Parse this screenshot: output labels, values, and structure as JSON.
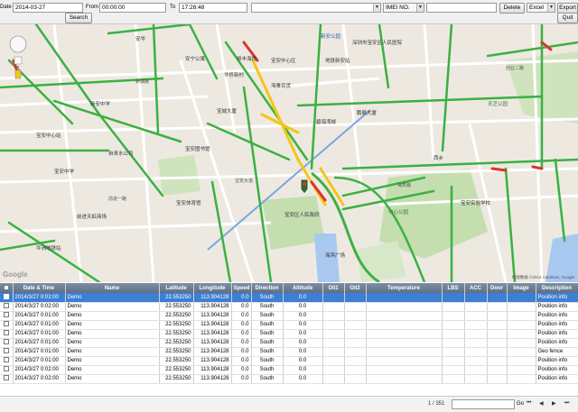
{
  "toolbar": {
    "date_label": "Date",
    "date_value": "2014-03-27",
    "from_label": "From",
    "from_value": "00:00:00",
    "to_label": "To",
    "to_value": "17:28:48",
    "device_value": "",
    "imei_label": "IMEI NO.",
    "imei_value": "",
    "search_label": "Search",
    "delete_label": "Delete",
    "export_format": "Excel",
    "export_label": "Export",
    "quit_label": "Quit"
  },
  "map": {
    "labels": [
      "安华",
      "安宁公寓",
      "新安公园",
      "深圳市宝安区人民医院",
      "地铁新安站",
      "宝安中心区",
      "华侨新村",
      "宝城大厦",
      "碧海湾城",
      "海雅百货",
      "恒丰海悦",
      "鹏展大厦",
      "宝安中心站",
      "宝安中学",
      "新安中学",
      "自来水公司",
      "前进天虹商场",
      "宝安体育馆",
      "宝安区人民政府",
      "中心公园",
      "海滨广场",
      "宝安图书馆",
      "西乡",
      "宝安实验学校",
      "坪洲地铁站",
      "灵芝公园",
      "前进一路",
      "创业二路",
      "宝安大道",
      "新湖路",
      "海秀路"
    ],
    "attribution": "地图数据 ©2014 AutoNavi, Google",
    "logo": "Google"
  },
  "table": {
    "columns": [
      "Date & Time",
      "Name",
      "Latitude",
      "Longitude",
      "Speed",
      "Direction",
      "Altitude",
      "Oil1",
      "Oil2",
      "Temperature",
      "LBS",
      "ACC",
      "Door",
      "Image",
      "Description"
    ],
    "rows": [
      [
        "2014/3/27 0:02:00",
        "Demo",
        "22.553250",
        "113.904128",
        "0.0",
        "South",
        "0.0",
        "",
        "",
        "",
        "",
        "",
        "",
        "",
        "Position info"
      ],
      [
        "2014/3/27 0:02:00",
        "Demo",
        "22.553250",
        "113.904128",
        "0.0",
        "South",
        "0.0",
        "",
        "",
        "",
        "",
        "",
        "",
        "",
        "Position info"
      ],
      [
        "2014/3/27 0:01:00",
        "Demo",
        "22.553250",
        "113.904128",
        "0.0",
        "South",
        "0.0",
        "",
        "",
        "",
        "",
        "",
        "",
        "",
        "Position info"
      ],
      [
        "2014/3/27 0:01:00",
        "Demo",
        "22.553250",
        "113.904128",
        "0.0",
        "South",
        "0.0",
        "",
        "",
        "",
        "",
        "",
        "",
        "",
        "Position info"
      ],
      [
        "2014/3/27 0:01:00",
        "Demo",
        "22.553250",
        "113.904128",
        "0.0",
        "South",
        "0.0",
        "",
        "",
        "",
        "",
        "",
        "",
        "",
        "Position info"
      ],
      [
        "2014/3/27 0:01:00",
        "Demo",
        "22.553250",
        "113.904128",
        "0.0",
        "South",
        "0.0",
        "",
        "",
        "",
        "",
        "",
        "",
        "",
        "Position info"
      ],
      [
        "2014/3/27 0:01:00",
        "Demo",
        "22.553250",
        "113.904128",
        "0.0",
        "South",
        "0.0",
        "",
        "",
        "",
        "",
        "",
        "",
        "",
        "Geo fence"
      ],
      [
        "2014/3/27 0:01:00",
        "Demo",
        "22.553250",
        "113.904128",
        "0.0",
        "South",
        "0.0",
        "",
        "",
        "",
        "",
        "",
        "",
        "",
        "Position info"
      ],
      [
        "2014/3/27 0:02:00",
        "Demo",
        "22.553250",
        "113.904128",
        "0.0",
        "South",
        "0.0",
        "",
        "",
        "",
        "",
        "",
        "",
        "",
        "Position info"
      ],
      [
        "2014/3/27 0:02:00",
        "Demo",
        "22.553250",
        "113.904128",
        "0.0",
        "South",
        "0.0",
        "",
        "",
        "",
        "",
        "",
        "",
        "",
        "Position info"
      ]
    ],
    "selected_row": 0
  },
  "pager": {
    "page_info": "1 / 351",
    "go_label": "Go",
    "first": "⏮",
    "prev": "◀",
    "next": "▶",
    "last": "⏭"
  },
  "colors": {
    "traffic_green": "#3cb043",
    "traffic_yellow": "#f5c518",
    "traffic_red": "#d9342b",
    "water": "#a8c8f0",
    "park": "#c4deb0",
    "header": "#6a7a92",
    "selection": "#3c7fd4"
  }
}
